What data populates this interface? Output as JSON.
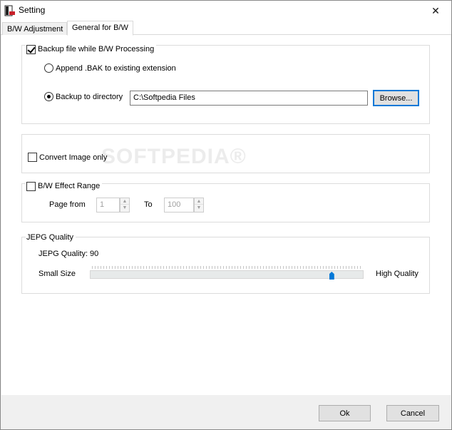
{
  "window": {
    "title": "Setting",
    "close_symbol": "✕"
  },
  "tabs": [
    {
      "label": "B/W Adjustment",
      "active": false
    },
    {
      "label": "General for B/W",
      "active": true
    }
  ],
  "backup_group": {
    "checkbox_label": "Backup file while B/W Processing",
    "checked": true,
    "append_option": {
      "label": "Append .BAK to existing  extension",
      "selected": false
    },
    "directory_option": {
      "label": "Backup to directory",
      "selected": true
    },
    "directory_value": "C:\\Softpedia Files",
    "browse_label": "Browse..."
  },
  "convert_group": {
    "checkbox_label": "Convert Image only",
    "checked": false
  },
  "watermark": "SOFTPEDIA®",
  "effect_range_group": {
    "checkbox_label": "B/W Effect Range",
    "checked": false,
    "page_from_label": "Page from",
    "page_from_value": "1",
    "to_label": "To",
    "to_value": "100"
  },
  "jpeg_group": {
    "title": "JEPG Quality",
    "quality_label": "JEPG Quality:",
    "quality_value": "90",
    "min_label": "Small Size",
    "max_label": "High Quality",
    "slider_value": 90,
    "slider_min": 0,
    "slider_max": 100
  },
  "footer": {
    "ok_label": "Ok",
    "cancel_label": "Cancel"
  },
  "icons": {
    "app": "app-icon",
    "close": "close-icon",
    "spin_up": "▲",
    "spin_down": "▼"
  },
  "colors": {
    "accent": "#0078d7",
    "window_bg": "#f0f0f0",
    "panel_bg": "#ffffff"
  }
}
